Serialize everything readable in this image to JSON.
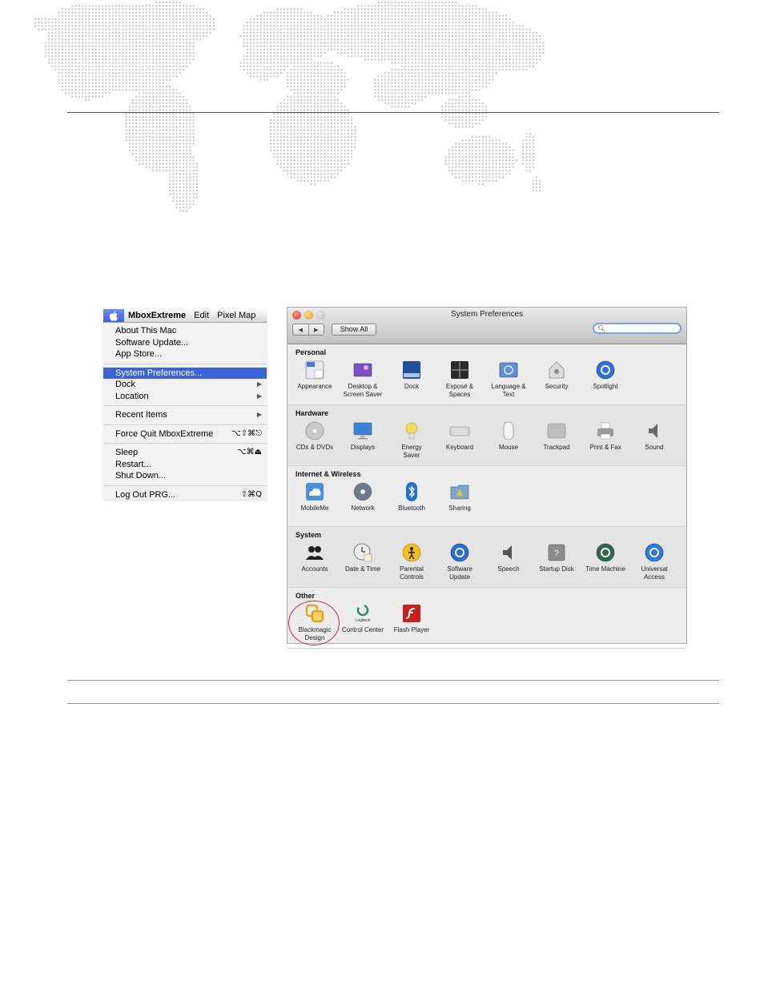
{
  "apple_menu": {
    "menubar": {
      "app_name": "MboxExtreme",
      "items": [
        "Edit",
        "Pixel Map"
      ]
    },
    "items": [
      {
        "label": "About This Mac",
        "shortcut": "",
        "submenu": false,
        "highlighted": false
      },
      {
        "label": "Software Update...",
        "shortcut": "",
        "submenu": false,
        "highlighted": false
      },
      {
        "label": "App Store...",
        "shortcut": "",
        "submenu": false,
        "highlighted": false
      },
      {
        "sep": true
      },
      {
        "label": "System Preferences...",
        "shortcut": "",
        "submenu": false,
        "highlighted": true
      },
      {
        "label": "Dock",
        "shortcut": "",
        "submenu": true,
        "highlighted": false
      },
      {
        "label": "Location",
        "shortcut": "",
        "submenu": true,
        "highlighted": false
      },
      {
        "sep": true
      },
      {
        "label": "Recent Items",
        "shortcut": "",
        "submenu": true,
        "highlighted": false
      },
      {
        "sep": true
      },
      {
        "label": "Force Quit MboxExtreme",
        "shortcut": "⌥⇧⌘⎋",
        "submenu": false,
        "highlighted": false
      },
      {
        "sep": true
      },
      {
        "label": "Sleep",
        "shortcut": "⌥⌘⏏",
        "submenu": false,
        "highlighted": false
      },
      {
        "label": "Restart...",
        "shortcut": "",
        "submenu": false,
        "highlighted": false
      },
      {
        "label": "Shut Down...",
        "shortcut": "",
        "submenu": false,
        "highlighted": false
      },
      {
        "sep": true
      },
      {
        "label": "Log Out PRG...",
        "shortcut": "⇧⌘Q",
        "submenu": false,
        "highlighted": false
      }
    ]
  },
  "system_preferences": {
    "title": "System Preferences",
    "show_all": "Show All",
    "search_placeholder": "",
    "sections": [
      {
        "title": "Personal",
        "panes": [
          {
            "label": "Appearance",
            "icon": "appearance-icon",
            "color": "#e8e8f0"
          },
          {
            "label": "Desktop &\nScreen Saver",
            "icon": "desktop-icon",
            "color": "#7b4fc9"
          },
          {
            "label": "Dock",
            "icon": "dock-icon",
            "color": "#1f4f9a"
          },
          {
            "label": "Exposé &\nSpaces",
            "icon": "expose-icon",
            "color": "#2b2b2b"
          },
          {
            "label": "Language &\nText",
            "icon": "language-icon",
            "color": "#5f8fd8"
          },
          {
            "label": "Security",
            "icon": "security-icon",
            "color": "#8a8a8a"
          },
          {
            "label": "Spotlight",
            "icon": "spotlight-icon",
            "color": "#2b6fe0"
          }
        ]
      },
      {
        "title": "Hardware",
        "panes": [
          {
            "label": "CDs & DVDs",
            "icon": "cd-icon",
            "color": "#c9c9c9"
          },
          {
            "label": "Displays",
            "icon": "displays-icon",
            "color": "#3a84d6"
          },
          {
            "label": "Energy\nSaver",
            "icon": "energy-icon",
            "color": "#f3d86a"
          },
          {
            "label": "Keyboard",
            "icon": "keyboard-icon",
            "color": "#d0d0d0"
          },
          {
            "label": "Mouse",
            "icon": "mouse-icon",
            "color": "#f5f5f5"
          },
          {
            "label": "Trackpad",
            "icon": "trackpad-icon",
            "color": "#bdbdbd"
          },
          {
            "label": "Print & Fax",
            "icon": "printer-icon",
            "color": "#9a9a9a"
          },
          {
            "label": "Sound",
            "icon": "sound-icon",
            "color": "#6a6a6a"
          }
        ]
      },
      {
        "title": "Internet & Wireless",
        "panes": [
          {
            "label": "MobileMe",
            "icon": "mobileme-icon",
            "color": "#4a90e0"
          },
          {
            "label": "Network",
            "icon": "network-icon",
            "color": "#6e7a8c"
          },
          {
            "label": "Bluetooth",
            "icon": "bluetooth-icon",
            "color": "#1e6fe0"
          },
          {
            "label": "Sharing",
            "icon": "sharing-icon",
            "color": "#7aa8c8"
          }
        ]
      },
      {
        "title": "System",
        "panes": [
          {
            "label": "Accounts",
            "icon": "accounts-icon",
            "color": "#222222"
          },
          {
            "label": "Date & Time",
            "icon": "datetime-icon",
            "color": "#eeeeee"
          },
          {
            "label": "Parental\nControls",
            "icon": "parental-icon",
            "color": "#f0c020"
          },
          {
            "label": "Software\nUpdate",
            "icon": "software-update-icon",
            "color": "#2a6fd0"
          },
          {
            "label": "Speech",
            "icon": "speech-icon",
            "color": "#555555"
          },
          {
            "label": "Startup Disk",
            "icon": "startup-disk-icon",
            "color": "#8c8c8c"
          },
          {
            "label": "Time Machine",
            "icon": "time-machine-icon",
            "color": "#2d6a4a"
          },
          {
            "label": "Universal\nAccess",
            "icon": "universal-access-icon",
            "color": "#2a7ae0"
          }
        ]
      },
      {
        "title": "Other",
        "panes": [
          {
            "label": "Blackmagic\nDesign",
            "icon": "blackmagic-icon",
            "color": "#e0a81c"
          },
          {
            "label": "Control Center",
            "icon": "logitech-icon",
            "color": "#2a8a6a",
            "icon_text": "Logitech"
          },
          {
            "label": "Flash Player",
            "icon": "flash-icon",
            "color": "#c81e1e"
          }
        ]
      }
    ]
  }
}
